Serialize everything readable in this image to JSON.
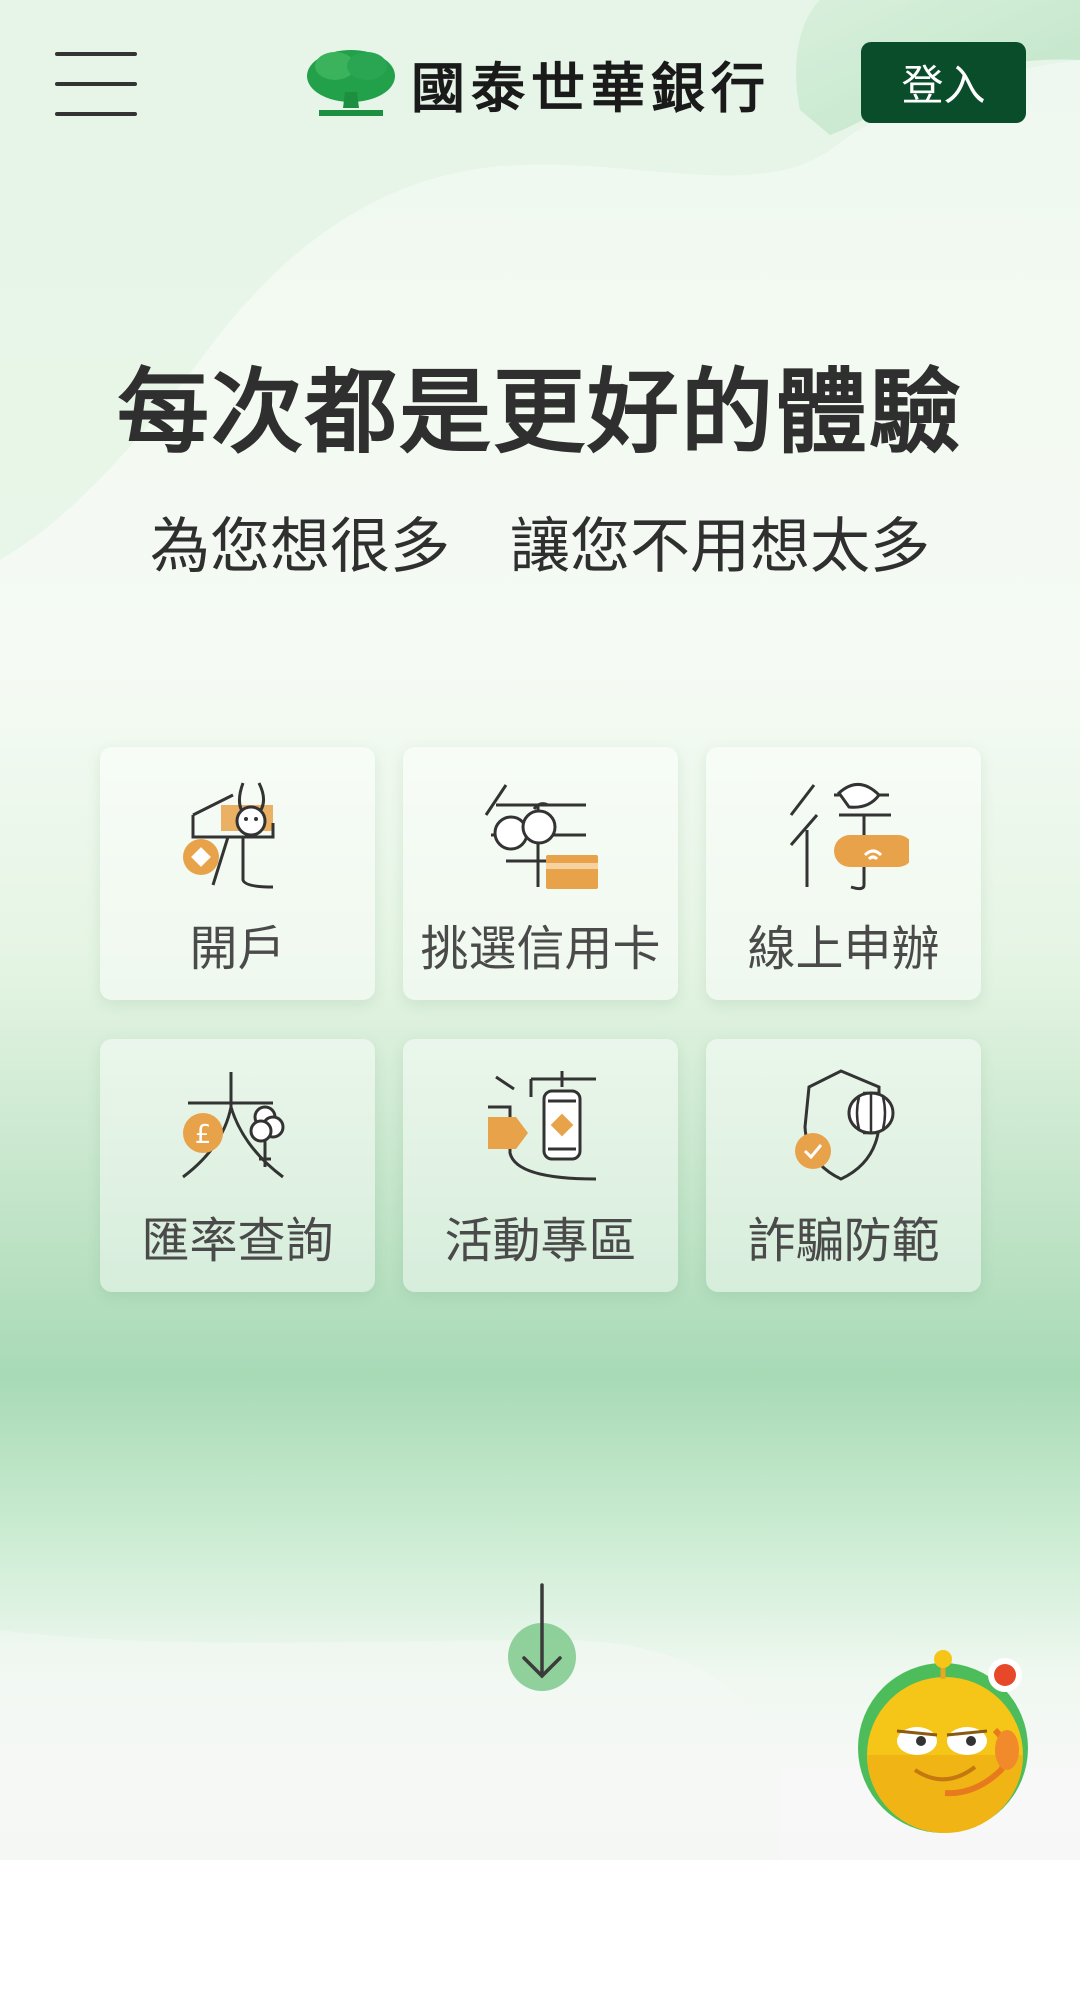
{
  "header": {
    "brand": "國泰世華銀行",
    "login_label": "登入"
  },
  "hero": {
    "title": "每次都是更好的體驗",
    "subtitle": "為您想很多　讓您不用想太多"
  },
  "tiles": [
    {
      "label": "開戶",
      "icon": "rabbit-icon"
    },
    {
      "label": "挑選信用卡",
      "icon": "orange-card-icon"
    },
    {
      "label": "線上申辦",
      "icon": "bird-phone-icon"
    },
    {
      "label": "匯率查詢",
      "icon": "pound-coin-icon"
    },
    {
      "label": "活動專區",
      "icon": "lantern-icon"
    },
    {
      "label": "詐騙防範",
      "icon": "shield-lantern-icon"
    }
  ],
  "colors": {
    "brand_green": "#0a4d2b",
    "accent_orange": "#e8a24a",
    "logo_green": "#22a04a"
  }
}
